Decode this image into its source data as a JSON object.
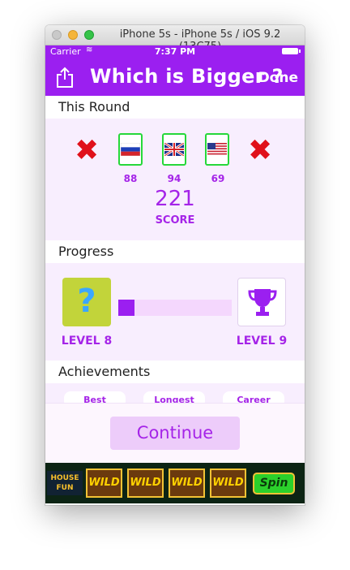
{
  "window": {
    "title": "iPhone 5s - iPhone 5s / iOS 9.2 (13C75)"
  },
  "status_bar": {
    "carrier": "Carrier",
    "time": "7:37 PM"
  },
  "nav": {
    "title": "Which is Bigger ?",
    "done_label": "Done",
    "share_icon": "share-icon"
  },
  "this_round": {
    "header": "This Round",
    "flags": [
      {
        "country": "Russia",
        "value": "88",
        "correct": true
      },
      {
        "country": "United Kingdom",
        "value": "94",
        "correct": true
      },
      {
        "country": "United States",
        "value": "69",
        "correct": true
      }
    ],
    "wrong_marks": [
      "left",
      "right"
    ],
    "score": "221",
    "score_label": "SCORE"
  },
  "progress": {
    "header": "Progress",
    "current_level": "LEVEL 8",
    "next_level": "LEVEL 9",
    "fraction": 0.14
  },
  "achievements": {
    "header": "Achievements",
    "tabs": [
      "Best",
      "Longest",
      "Career"
    ]
  },
  "continue_label": "Continue",
  "ad": {
    "logo": "HOUSE FUN",
    "reels": [
      "WILD",
      "WILD",
      "WILD",
      "WILD"
    ],
    "spin_label": "Spin"
  },
  "colors": {
    "accent": "#9b1ff0",
    "text_accent": "#a524e8",
    "panel": "#f8eefe",
    "correct": "#26d83a",
    "wrong": "#e0101a"
  }
}
